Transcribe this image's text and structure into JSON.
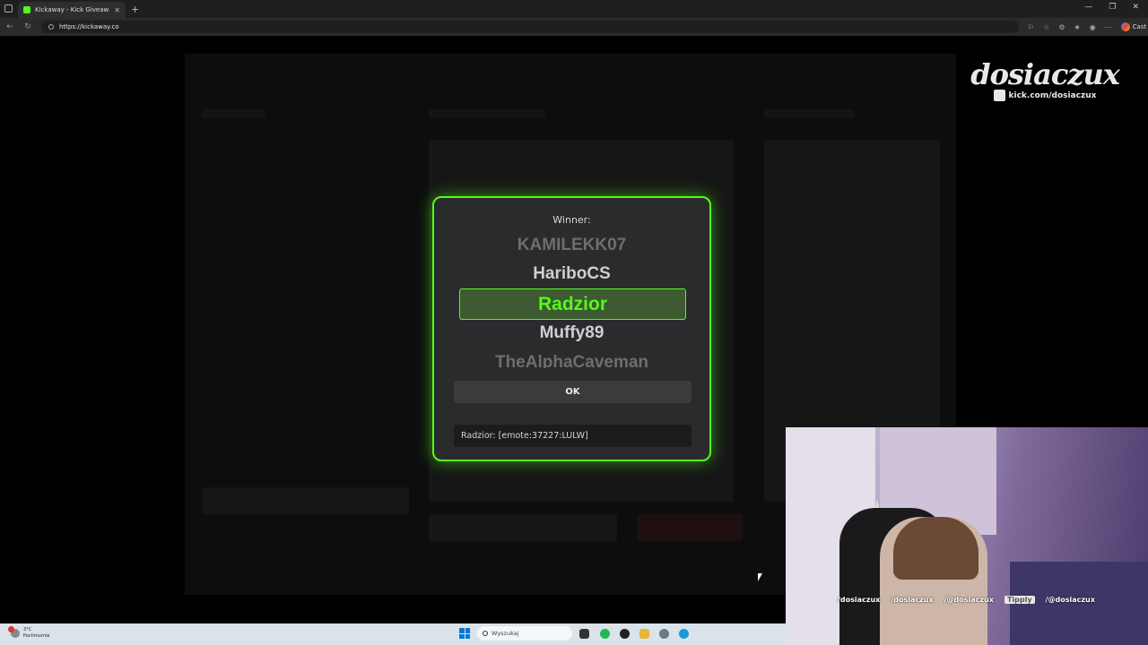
{
  "browser": {
    "tab_title": "Kickaway - Kick Giveaway Tool",
    "url": "https://kickaway.co",
    "cast_label": "Cast"
  },
  "modal": {
    "winner_label": "Winner:",
    "names": [
      "KAMILEKK07",
      "HariboCS",
      "Radzior",
      "Muffy89",
      "TheAlphaCaveman"
    ],
    "selected_name": "Radzior",
    "ok_label": "OK",
    "chat_message": "Radzior: [emote:37227:LULW]"
  },
  "overlay": {
    "logo_text": "dosiaczux",
    "channel_url": "kick.com/dosiaczux",
    "socials": [
      "/dosiaczux",
      "/dosiaczux",
      "/@dosiaczux",
      "Tipply",
      "/@dosiaczux"
    ]
  },
  "taskbar": {
    "temperature": "3°C",
    "weather_text": "Pochmurnie",
    "weather_badge": "4",
    "search_placeholder": "Wyszukaj"
  },
  "colors": {
    "accent": "#53fc18",
    "modal_bg": "#2a2b2d",
    "page_bg": "#000000"
  }
}
